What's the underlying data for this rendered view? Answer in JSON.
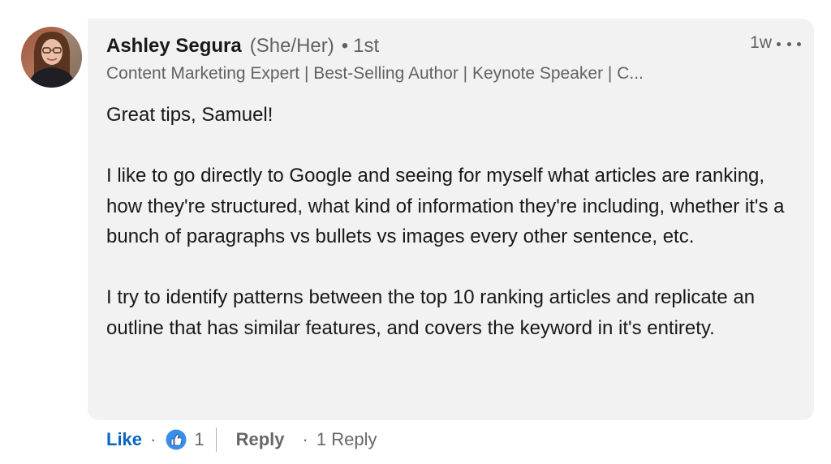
{
  "comment": {
    "author": {
      "name": "Ashley Segura",
      "pronouns": "(She/Her)",
      "separator": "•",
      "degree": "1st",
      "headline": "Content Marketing Expert | Best-Selling Author | Keynote Speaker | C..."
    },
    "timestamp": "1w",
    "more_icon": "more-horizontal-icon",
    "body": {
      "greeting": "Great tips, Samuel!",
      "paragraph_1": "I like to go directly to Google and seeing for myself what articles are ranking, how they're structured, what kind of information they're including, whether it's a bunch of paragraphs vs bullets vs images every other sentence, etc.",
      "paragraph_2": "I try to identify patterns between the top 10 ranking articles and replicate an outline that has similar features, and covers the keyword in it's entirety."
    }
  },
  "actions": {
    "like_label": "Like",
    "dot": "·",
    "reaction_icon": "like-thumbs-up-icon",
    "reaction_count": "1",
    "reply_label": "Reply",
    "reply_count_label": "1 Reply"
  },
  "colors": {
    "bubble_background": "#f2f2f2",
    "link_blue": "#0a66c2",
    "reaction_blue": "#378fe9",
    "muted_text": "#666666"
  }
}
